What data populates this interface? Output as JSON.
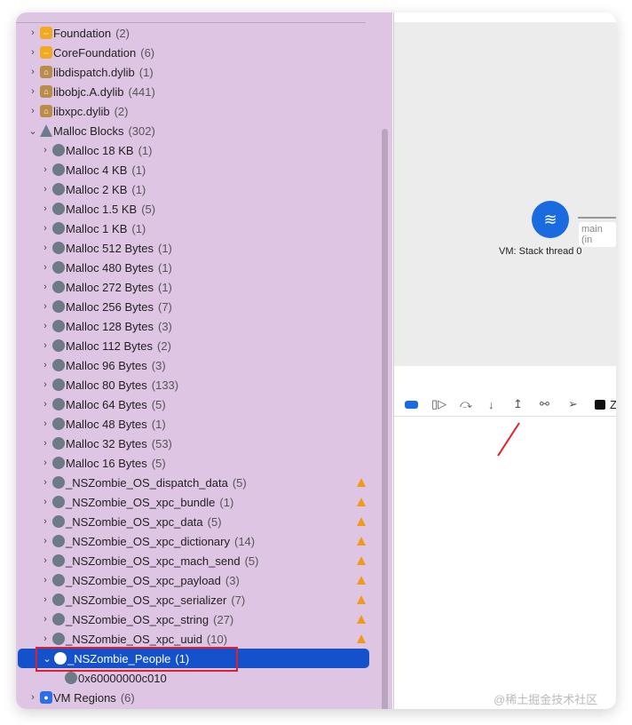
{
  "tree": [
    {
      "level": 0,
      "chev": "right",
      "icon": "framework",
      "label": "Foundation",
      "count": "(2)"
    },
    {
      "level": 0,
      "chev": "right",
      "icon": "framework",
      "label": "CoreFoundation",
      "count": "(6)"
    },
    {
      "level": 0,
      "chev": "right",
      "icon": "library",
      "label": "libdispatch.dylib",
      "count": "(1)"
    },
    {
      "level": 0,
      "chev": "right",
      "icon": "library",
      "label": "libobjc.A.dylib",
      "count": "(441)"
    },
    {
      "level": 0,
      "chev": "right",
      "icon": "library",
      "label": "libxpc.dylib",
      "count": "(2)"
    },
    {
      "level": 0,
      "chev": "down",
      "icon": "malloc",
      "label": "Malloc Blocks",
      "count": "(302)"
    },
    {
      "level": 1,
      "chev": "right",
      "icon": "cube",
      "label": "Malloc 18 KB",
      "count": "(1)"
    },
    {
      "level": 1,
      "chev": "right",
      "icon": "cube",
      "label": "Malloc 4 KB",
      "count": "(1)"
    },
    {
      "level": 1,
      "chev": "right",
      "icon": "cube",
      "label": "Malloc 2 KB",
      "count": "(1)"
    },
    {
      "level": 1,
      "chev": "right",
      "icon": "cube",
      "label": "Malloc 1.5 KB",
      "count": "(5)"
    },
    {
      "level": 1,
      "chev": "right",
      "icon": "cube",
      "label": "Malloc 1 KB",
      "count": "(1)"
    },
    {
      "level": 1,
      "chev": "right",
      "icon": "cube",
      "label": "Malloc 512 Bytes",
      "count": "(1)"
    },
    {
      "level": 1,
      "chev": "right",
      "icon": "cube",
      "label": "Malloc 480 Bytes",
      "count": "(1)"
    },
    {
      "level": 1,
      "chev": "right",
      "icon": "cube",
      "label": "Malloc 272 Bytes",
      "count": "(1)"
    },
    {
      "level": 1,
      "chev": "right",
      "icon": "cube",
      "label": "Malloc 256 Bytes",
      "count": "(7)"
    },
    {
      "level": 1,
      "chev": "right",
      "icon": "cube",
      "label": "Malloc 128 Bytes",
      "count": "(3)"
    },
    {
      "level": 1,
      "chev": "right",
      "icon": "cube",
      "label": "Malloc 112 Bytes",
      "count": "(2)"
    },
    {
      "level": 1,
      "chev": "right",
      "icon": "cube",
      "label": "Malloc 96 Bytes",
      "count": "(3)"
    },
    {
      "level": 1,
      "chev": "right",
      "icon": "cube",
      "label": "Malloc 80 Bytes",
      "count": "(133)"
    },
    {
      "level": 1,
      "chev": "right",
      "icon": "cube",
      "label": "Malloc 64 Bytes",
      "count": "(5)"
    },
    {
      "level": 1,
      "chev": "right",
      "icon": "cube",
      "label": "Malloc 48 Bytes",
      "count": "(1)"
    },
    {
      "level": 1,
      "chev": "right",
      "icon": "cube",
      "label": "Malloc 32 Bytes",
      "count": "(53)"
    },
    {
      "level": 1,
      "chev": "right",
      "icon": "cube",
      "label": "Malloc 16 Bytes",
      "count": "(5)"
    },
    {
      "level": 1,
      "chev": "right",
      "icon": "cube",
      "label": "_NSZombie_OS_dispatch_data",
      "count": "(5)",
      "warning": true
    },
    {
      "level": 1,
      "chev": "right",
      "icon": "cube",
      "label": "_NSZombie_OS_xpc_bundle",
      "count": "(1)",
      "warning": true
    },
    {
      "level": 1,
      "chev": "right",
      "icon": "cube",
      "label": "_NSZombie_OS_xpc_data",
      "count": "(5)",
      "warning": true
    },
    {
      "level": 1,
      "chev": "right",
      "icon": "cube",
      "label": "_NSZombie_OS_xpc_dictionary",
      "count": "(14)",
      "warning": true
    },
    {
      "level": 1,
      "chev": "right",
      "icon": "cube",
      "label": "_NSZombie_OS_xpc_mach_send",
      "count": "(5)",
      "warning": true
    },
    {
      "level": 1,
      "chev": "right",
      "icon": "cube",
      "label": "_NSZombie_OS_xpc_payload",
      "count": "(3)",
      "warning": true
    },
    {
      "level": 1,
      "chev": "right",
      "icon": "cube",
      "label": "_NSZombie_OS_xpc_serializer",
      "count": "(7)",
      "warning": true
    },
    {
      "level": 1,
      "chev": "right",
      "icon": "cube",
      "label": "_NSZombie_OS_xpc_string",
      "count": "(27)",
      "warning": true
    },
    {
      "level": 1,
      "chev": "right",
      "icon": "cube",
      "label": "_NSZombie_OS_xpc_uuid",
      "count": "(10)",
      "warning": true
    },
    {
      "level": 1,
      "chev": "down",
      "icon": "cube",
      "label": "_NSZombie_People",
      "count": "(1)",
      "selected": true
    },
    {
      "level": 2,
      "chev": "none",
      "icon": "cube",
      "label": "0x60000000c010",
      "count": ""
    },
    {
      "level": 0,
      "chev": "right",
      "icon": "vm",
      "label": "VM Regions",
      "count": "(6)"
    }
  ],
  "graph": {
    "node_label": "VM: Stack thread 0",
    "edge_label": "main (in"
  },
  "toolbar": {
    "terminal_label": "Z"
  },
  "watermark": "@稀土掘金技术社区",
  "colors": {
    "sidebar": "#dfc5e4",
    "selection": "#1452cc",
    "accent": "#1a6ae0",
    "warning": "#f09a1a",
    "highlight_box": "#e0202a"
  }
}
